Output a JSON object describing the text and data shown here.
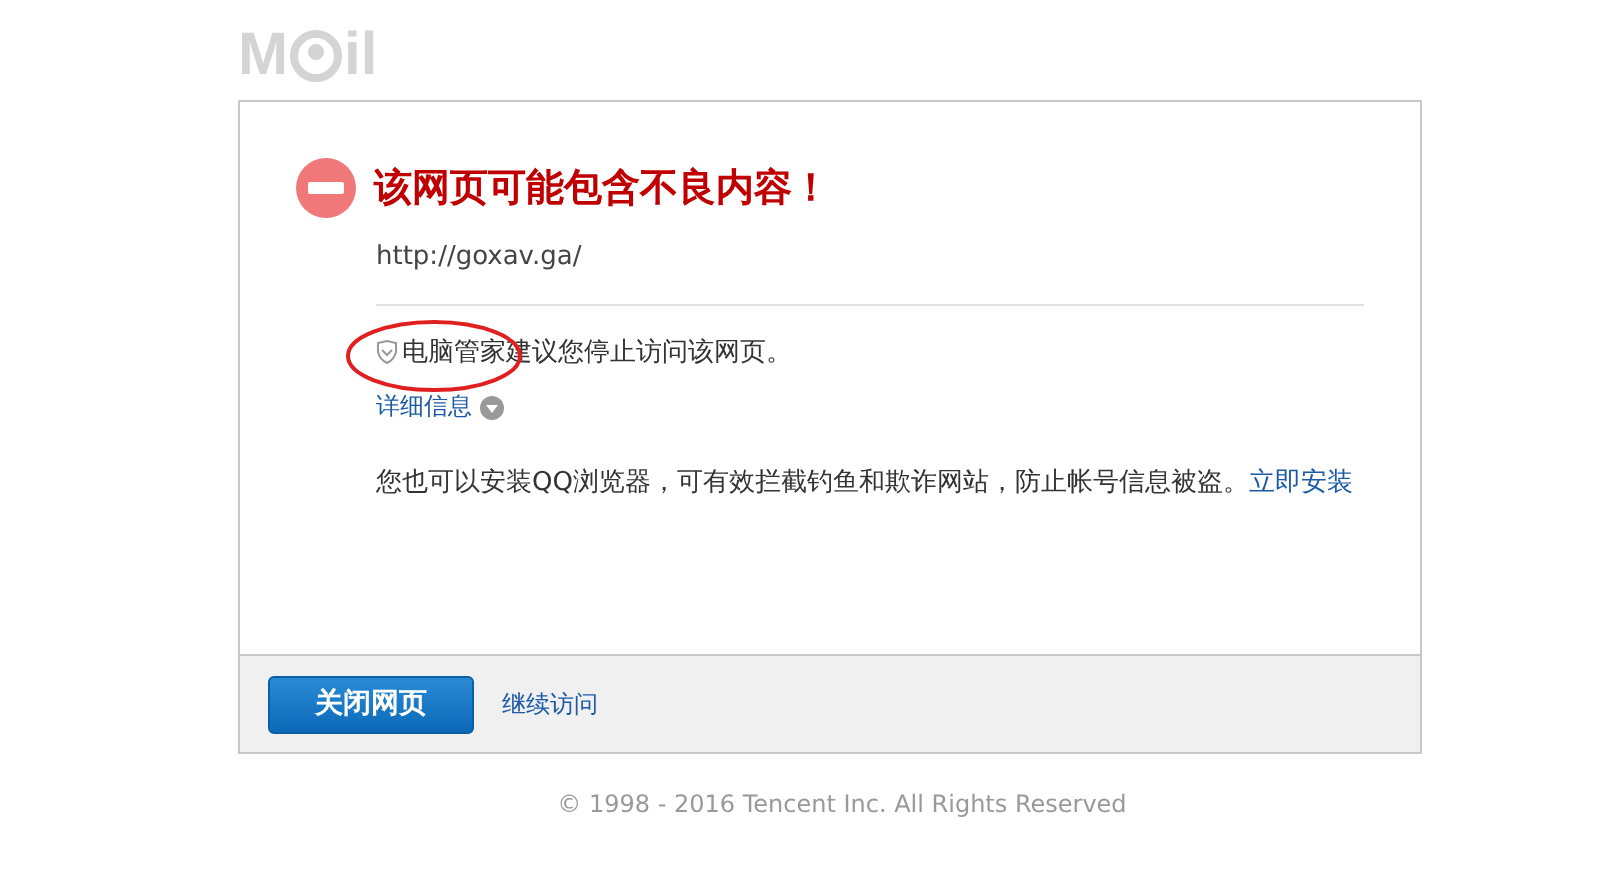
{
  "logo": {
    "left": "M",
    "right": "il"
  },
  "warning": {
    "title": "该网页可能包含不良内容！",
    "url": "http://goxav.ga/",
    "advice": "电脑管家建议您停止访问该网页。",
    "details_link": "详细信息",
    "install_text": "您也可以安装QQ浏览器，可有效拦截钓鱼和欺诈网站，防止帐号信息被盗。",
    "install_link": "立即安装"
  },
  "buttons": {
    "primary": "关闭网页",
    "secondary": "继续访问"
  },
  "copyright": "© 1998 - 2016 Tencent Inc. All Rights Reserved"
}
